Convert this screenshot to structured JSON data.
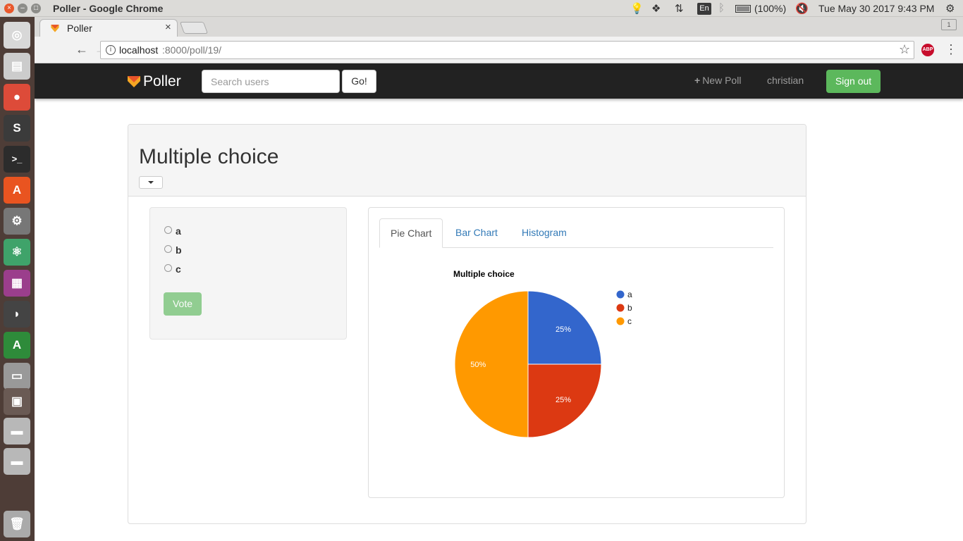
{
  "system": {
    "window_title": "Poller - Google Chrome",
    "keyboard": "En",
    "battery": "(100%)",
    "clock": "Tue May 30 2017  9:43 PM"
  },
  "browser": {
    "tab_title": "Poller",
    "tab_close": "×",
    "profile_label": "1",
    "url_host": "localhost",
    "url_rest": ":8000/poll/19/",
    "abp_label": "ABP"
  },
  "launcher": {
    "items": [
      {
        "icon": "ubuntu-logo-icon",
        "color": "#d8d8d8",
        "glyph": "◎"
      },
      {
        "icon": "files-icon",
        "color": "#cccccc",
        "glyph": "▤"
      },
      {
        "icon": "chrome-icon",
        "color": "#dd4b39",
        "glyph": "●"
      },
      {
        "icon": "sublime-text-icon",
        "color": "#3b3b3b",
        "glyph": "S"
      },
      {
        "icon": "terminal-icon",
        "color": "#2c2c2c",
        "glyph": ">_"
      },
      {
        "icon": "software-center-icon",
        "color": "#e95420",
        "glyph": "A"
      },
      {
        "icon": "settings-tools-icon",
        "color": "#777777",
        "glyph": "⚙"
      },
      {
        "icon": "atom-icon",
        "color": "#3fa36a",
        "glyph": "⚛"
      },
      {
        "icon": "app-window-icon",
        "color": "#9b3e8c",
        "glyph": "▦"
      },
      {
        "icon": "gedit-icon",
        "color": "#444444",
        "glyph": "◗"
      },
      {
        "icon": "software-updater-icon",
        "color": "#2e8b3a",
        "glyph": "A"
      },
      {
        "icon": "scanner-icon",
        "color": "#999999",
        "glyph": "▭"
      },
      {
        "icon": "workspaces-icon",
        "color": "#6a5a54",
        "glyph": "▣"
      },
      {
        "icon": "drive-icon",
        "color": "#b8b8b8",
        "glyph": "▬"
      },
      {
        "icon": "drive-icon",
        "color": "#b8b8b8",
        "glyph": "▬"
      },
      {
        "icon": "trash-icon",
        "color": "#aaaaaa",
        "glyph": "🗑"
      }
    ]
  },
  "nav": {
    "brand": "Poller",
    "search_placeholder": "Search users",
    "go_label": "Go!",
    "new_poll_label": "New Poll",
    "username": "christian",
    "sign_out_label": "Sign out"
  },
  "poll": {
    "title": "Multiple choice",
    "options": [
      "a",
      "b",
      "c"
    ],
    "vote_label": "Vote"
  },
  "chart_tabs": [
    "Pie Chart",
    "Bar Chart",
    "Histogram"
  ],
  "chart_data": {
    "type": "pie",
    "title": "Multiple choice",
    "categories": [
      "a",
      "b",
      "c"
    ],
    "values": [
      25,
      25,
      50
    ],
    "labels": [
      "25%",
      "25%",
      "50%"
    ],
    "colors": [
      "#3366cc",
      "#dc3912",
      "#ff9900"
    ],
    "legend_position": "right"
  }
}
